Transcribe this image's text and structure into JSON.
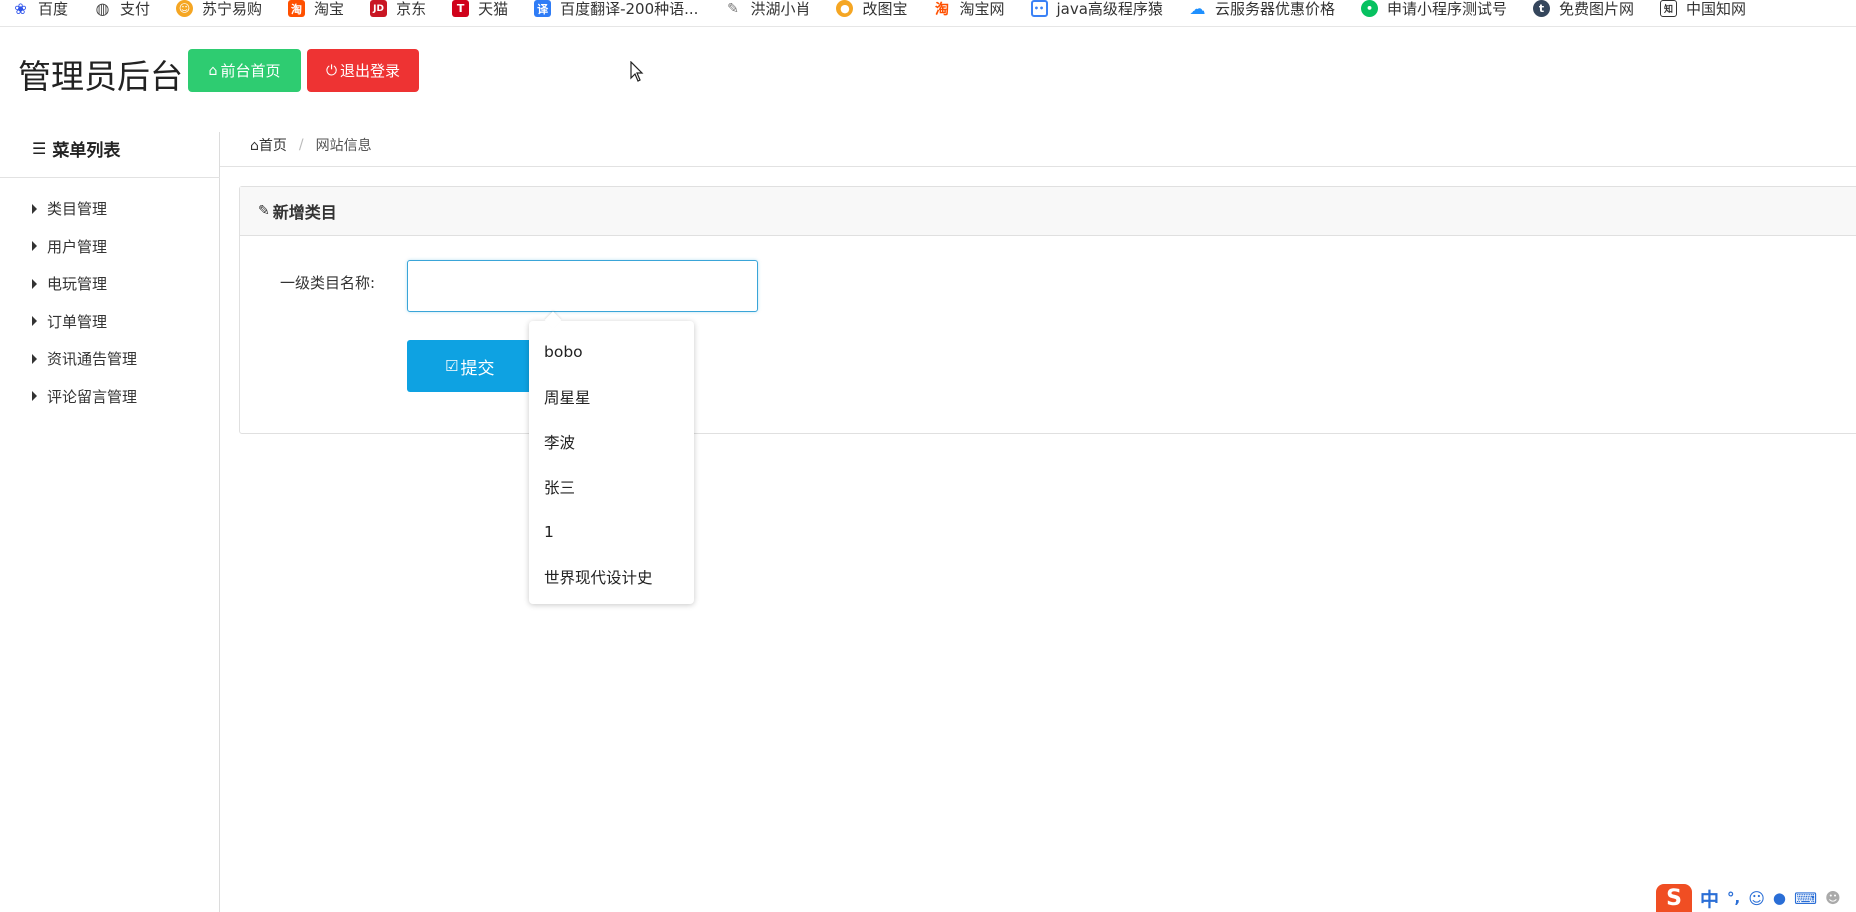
{
  "bookmarks": [
    {
      "label": "百度",
      "icon": "baidu-paw-icon",
      "color": "#2f54eb"
    },
    {
      "label": "支付",
      "icon": "globe-icon",
      "color": "#444444"
    },
    {
      "label": "苏宁易购",
      "icon": "suning-lion-icon",
      "color": "#f5a623"
    },
    {
      "label": "淘宝",
      "icon": "taobao-icon",
      "color": "#ff5000"
    },
    {
      "label": "京东",
      "icon": "jd-icon",
      "color": "#c91623"
    },
    {
      "label": "天猫",
      "icon": "tmall-icon",
      "color": "#d0021b"
    },
    {
      "label": "百度翻译-200种语...",
      "icon": "translate-icon",
      "color": "#2f7cf6"
    },
    {
      "label": "洪湖小肖",
      "icon": "bird-icon",
      "color": "#888888"
    },
    {
      "label": "改图宝",
      "icon": "image-edit-icon",
      "color": "#f5a623"
    },
    {
      "label": "淘宝网",
      "icon": "taobao-icon",
      "color": "#ff5000"
    },
    {
      "label": "java高级程序猿",
      "icon": "robot-icon",
      "color": "#3b82f6"
    },
    {
      "label": "云服务器优惠价格",
      "icon": "cloud-icon",
      "color": "#1e90ff"
    },
    {
      "label": "申请小程序测试号",
      "icon": "wechat-icon",
      "color": "#07c160"
    },
    {
      "label": "免费图片网",
      "icon": "tumblr-icon",
      "color": "#35465c"
    },
    {
      "label": "中国知网",
      "icon": "cnki-icon",
      "color": "#333333"
    }
  ],
  "header": {
    "title": "管理员后台",
    "home_button": "前台首页",
    "logout_button": "退出登录",
    "home_color": "#2ecc71",
    "logout_color": "#ee3333"
  },
  "sidebar": {
    "title": "菜单列表",
    "items": [
      {
        "label": "类目管理"
      },
      {
        "label": "用户管理"
      },
      {
        "label": "电玩管理"
      },
      {
        "label": "订单管理"
      },
      {
        "label": "资讯通告管理"
      },
      {
        "label": "评论留言管理"
      }
    ]
  },
  "breadcrumb": {
    "home": "首页",
    "current": "网站信息"
  },
  "panel": {
    "heading": "新增类目",
    "field_label": "一级类目名称:",
    "field_value": "",
    "submit_label": "提交",
    "accent_color": "#0ea2e2"
  },
  "autocomplete": {
    "options": [
      "bobo",
      "周星星",
      "李波",
      "张三",
      "1",
      "世界现代设计史"
    ]
  },
  "ime": {
    "mode": "中",
    "punct": "°,"
  }
}
